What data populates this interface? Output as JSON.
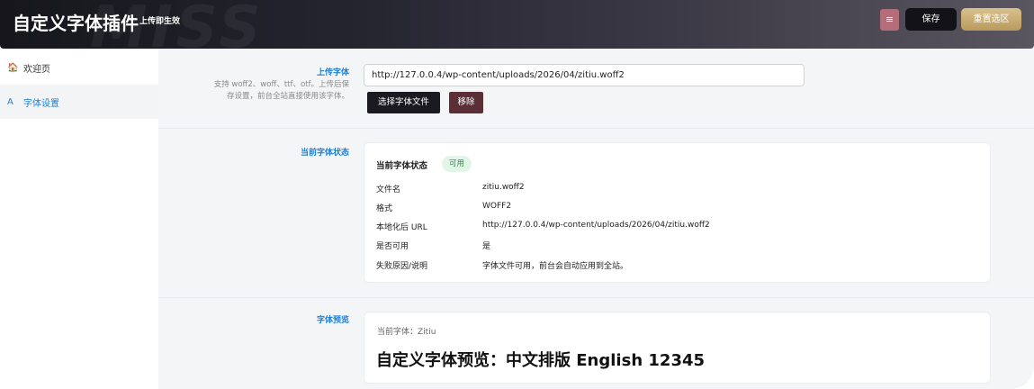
{
  "header": {
    "title": "自定义字体插件",
    "subtitle": "上传即生效",
    "watermark": "MISS",
    "menu_icon": "≡",
    "save_label": "保存",
    "reset_label": "重置选区"
  },
  "sidebar": {
    "items": [
      {
        "icon": "🏠",
        "icon_name": "home-icon",
        "label": "欢迎页"
      },
      {
        "icon": "A",
        "icon_name": "font-icon",
        "label": "字体设置"
      }
    ]
  },
  "upload": {
    "label": "上传字体",
    "help_line1": "支持 woff2、woff、ttf、otf。上传后保",
    "help_line2": "存设置，前台全站直接使用该字体。",
    "url_value": "http://127.0.0.4/wp-content/uploads/2026/04/zitiu.woff2",
    "choose_label": "选择字体文件",
    "remove_label": "移除"
  },
  "status": {
    "label": "当前字体状态",
    "card_title": "当前字体状态",
    "badge": "可用",
    "rows": [
      {
        "key": "文件名",
        "value": "zitiu.woff2"
      },
      {
        "key": "格式",
        "value": "WOFF2"
      },
      {
        "key": "本地化后 URL",
        "value": "http://127.0.0.4/wp-content/uploads/2026/04/zitiu.woff2"
      },
      {
        "key": "是否可用",
        "value": "是"
      },
      {
        "key": "失败原因/说明",
        "value": "字体文件可用，前台会自动应用到全站。"
      }
    ]
  },
  "preview": {
    "label": "字体预览",
    "current_font": "当前字体：Zitiu",
    "sample": "自定义字体预览：中文排版 English 12345"
  },
  "colors": {
    "accent": "#1f7ed0",
    "header_dark": "#16161c",
    "menu_button": "#b56d79",
    "reset_gold": "#c9ab6e",
    "remove_button": "#5b2f35",
    "badge_green": "#2c8b48"
  }
}
